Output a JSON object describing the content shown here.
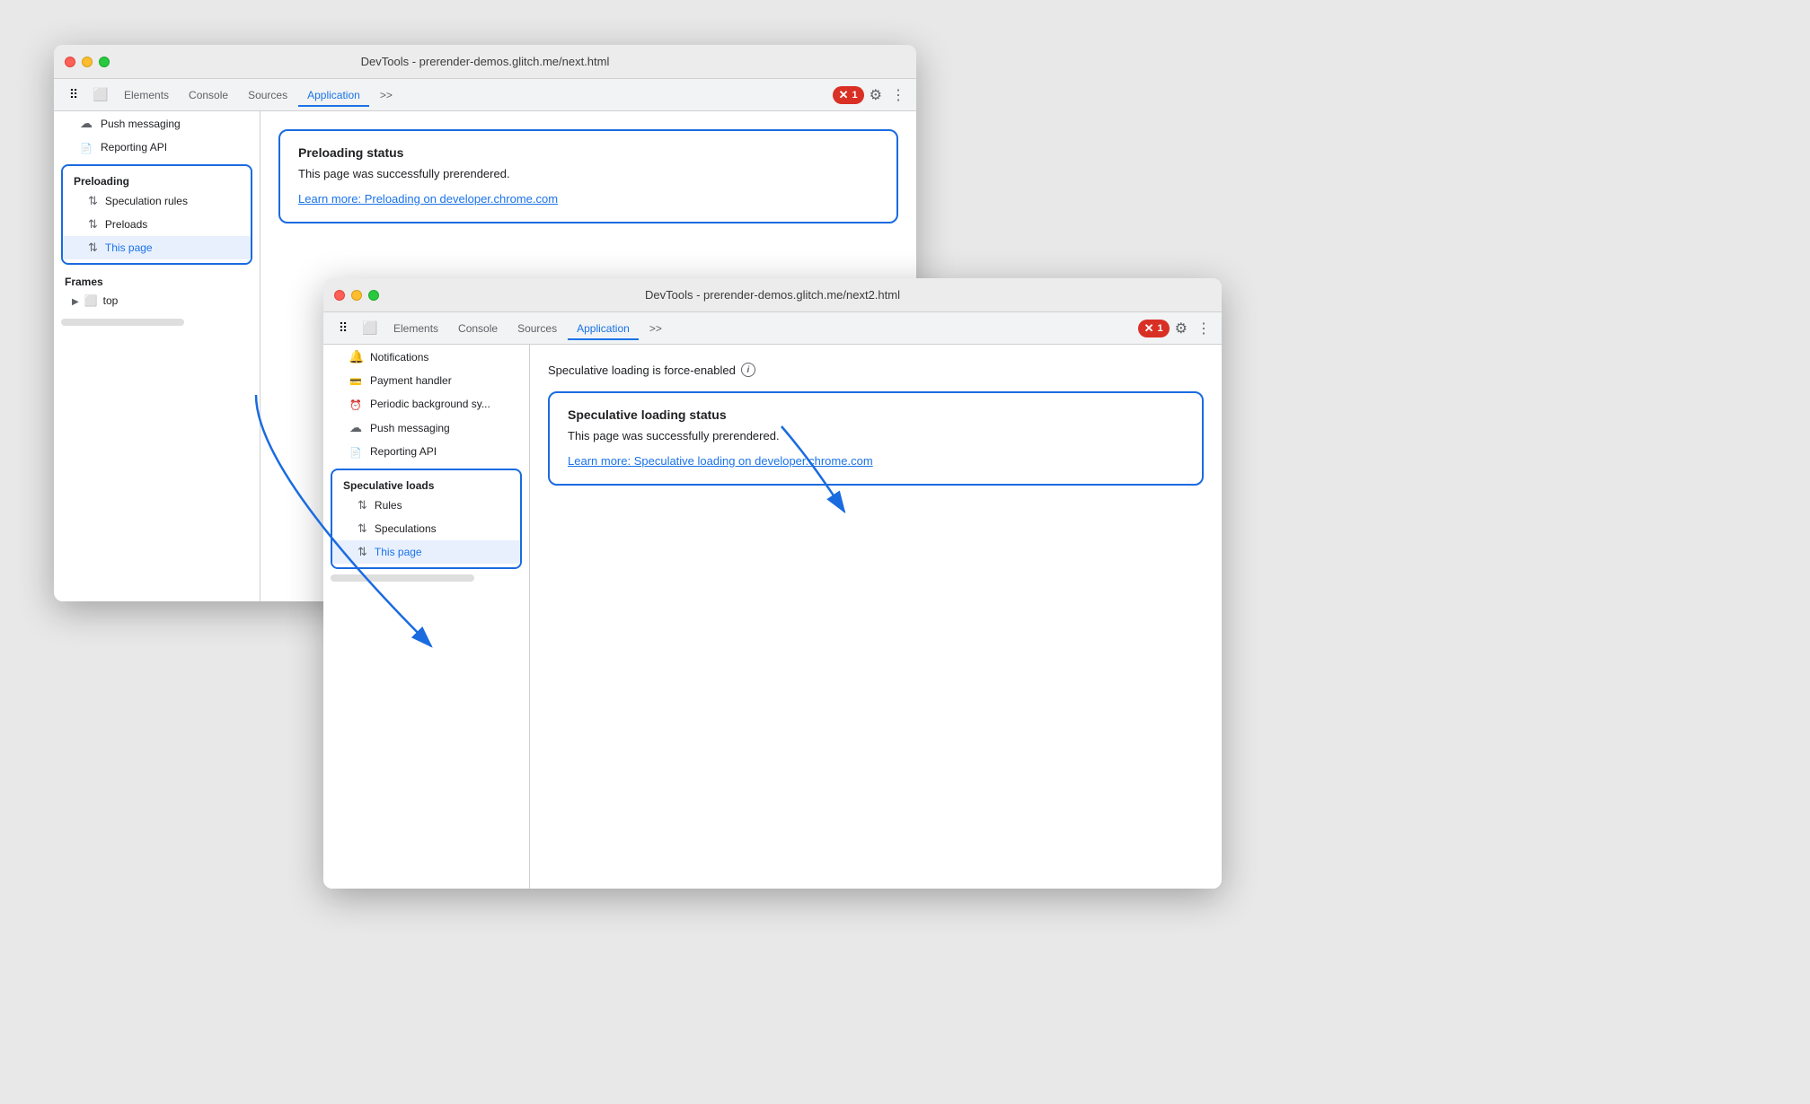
{
  "window1": {
    "title": "DevTools - prerender-demos.glitch.me/next.html",
    "tabs": [
      {
        "label": "Elements",
        "active": false
      },
      {
        "label": "Console",
        "active": false
      },
      {
        "label": "Sources",
        "active": false
      },
      {
        "label": "Application",
        "active": true
      },
      {
        "label": ">>",
        "active": false
      }
    ],
    "error_count": "1",
    "sidebar": {
      "push_messaging": "Push messaging",
      "reporting_api": "Reporting API",
      "preloading_group_label": "Preloading",
      "speculation_rules": "Speculation rules",
      "preloads": "Preloads",
      "this_page": "This page",
      "frames_label": "Frames",
      "top_label": "top"
    },
    "main": {
      "preloading_status_title": "Preloading status",
      "preloading_status_text": "This page was successfully prerendered.",
      "preloading_status_link": "Learn more: Preloading on developer.chrome.com"
    }
  },
  "window2": {
    "title": "DevTools - prerender-demos.glitch.me/next2.html",
    "tabs": [
      {
        "label": "Elements",
        "active": false
      },
      {
        "label": "Console",
        "active": false
      },
      {
        "label": "Sources",
        "active": false
      },
      {
        "label": "Application",
        "active": true
      },
      {
        "label": ">>",
        "active": false
      }
    ],
    "error_count": "1",
    "sidebar": {
      "notifications": "Notifications",
      "payment_handler": "Payment handler",
      "periodic_background": "Periodic background sy...",
      "push_messaging": "Push messaging",
      "reporting_api": "Reporting API",
      "speculative_loads_group_label": "Speculative loads",
      "rules": "Rules",
      "speculations": "Speculations",
      "this_page": "This page"
    },
    "main": {
      "force_enabled_text": "Speculative loading is force-enabled",
      "speculative_status_title": "Speculative loading status",
      "speculative_status_text": "This page was successfully prerendered.",
      "speculative_status_link": "Learn more: Speculative loading on developer.chrome.com"
    }
  }
}
